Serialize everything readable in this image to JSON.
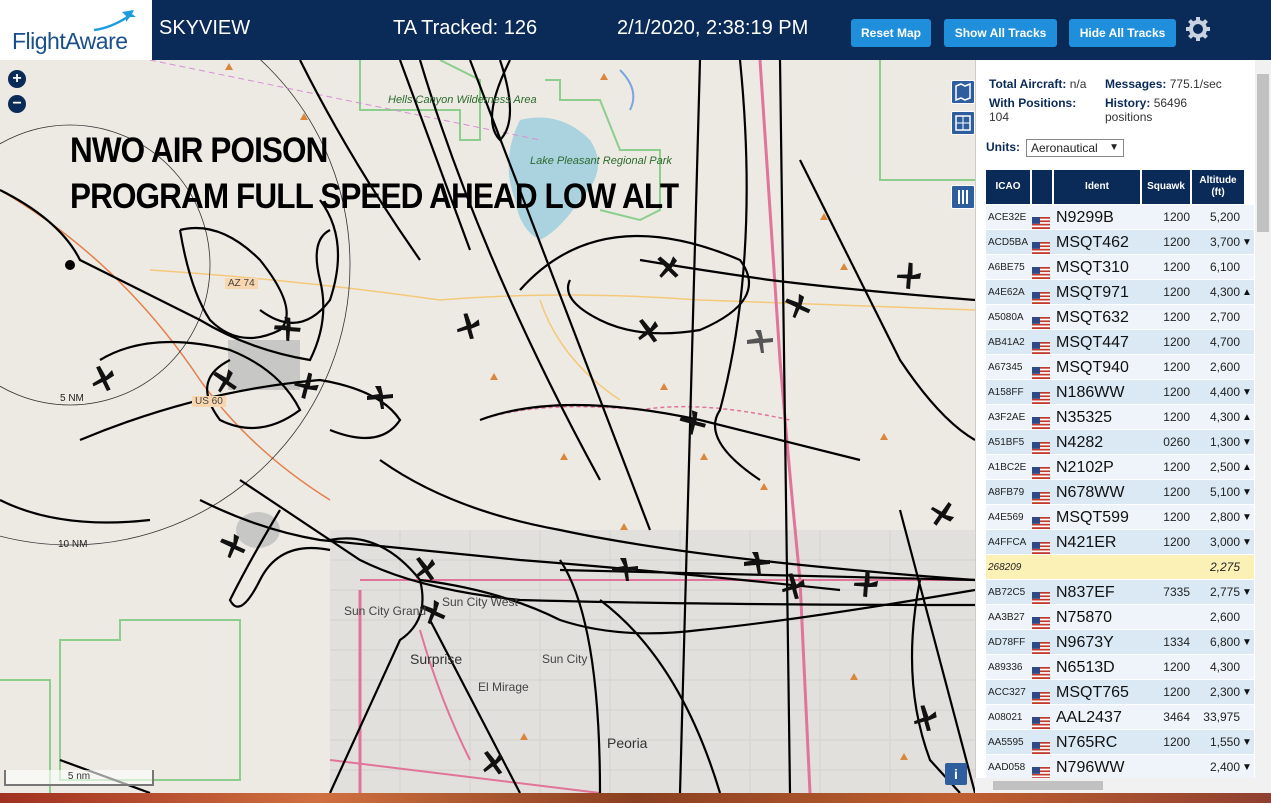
{
  "header": {
    "logo_text": "FlightAware",
    "app_title": "SKYVIEW",
    "tracked": "TA Tracked: 126",
    "datetime": "2/1/2020, 2:38:19 PM",
    "reset_label": "Reset Map",
    "show_label": "Show All Tracks",
    "hide_label": "Hide All Tracks",
    "settings_icon": "gear-icon"
  },
  "map": {
    "zoom_in": "+",
    "zoom_out": "−",
    "overlay_line1": "NWO AIR POISON",
    "overlay_line2": "PROGRAM FULL SPEED AHEAD LOW ALT",
    "ring_5": "5 NM",
    "ring_10": "10 NM",
    "scale_label": "5 nm",
    "info": "i",
    "places": {
      "hells_canyon": "Hells Canyon Wilderness Area",
      "lake_pleasant": "Lake Pleasant Regional Park",
      "sun_city_grand": "Sun City Grand",
      "sun_city_west": "Sun City West",
      "surprise": "Surprise",
      "sun_city": "Sun City",
      "el_mirage": "El Mirage",
      "peoria": "Peoria",
      "az74": "AZ 74",
      "us60": "US 60"
    }
  },
  "panel": {
    "total_label": "Total Aircraft:",
    "total_value": "n/a",
    "messages_label": "Messages:",
    "messages_value": "775.1/sec",
    "positions_label": "With Positions:",
    "positions_value": "104",
    "history_label": "History:",
    "history_value": "56496 positions",
    "units_label": "Units:",
    "units_value": "Aeronautical",
    "columns": [
      "ICAO",
      "Ident",
      "Squawk",
      "Altitude (ft)"
    ],
    "rows": [
      {
        "icao": "ACE32E",
        "ident": "N9299B",
        "squawk": "1200",
        "alt": "5,200",
        "trend": ""
      },
      {
        "icao": "ACD5BA",
        "ident": "MSQT462",
        "squawk": "1200",
        "alt": "3,700",
        "trend": "▼"
      },
      {
        "icao": "A6BE75",
        "ident": "MSQT310",
        "squawk": "1200",
        "alt": "6,100",
        "trend": ""
      },
      {
        "icao": "A4E62A",
        "ident": "MSQT971",
        "squawk": "1200",
        "alt": "4,300",
        "trend": "▲"
      },
      {
        "icao": "A5080A",
        "ident": "MSQT632",
        "squawk": "1200",
        "alt": "2,700",
        "trend": ""
      },
      {
        "icao": "AB41A2",
        "ident": "MSQT447",
        "squawk": "1200",
        "alt": "4,700",
        "trend": ""
      },
      {
        "icao": "A67345",
        "ident": "MSQT940",
        "squawk": "1200",
        "alt": "2,600",
        "trend": ""
      },
      {
        "icao": "A158FF",
        "ident": "N186WW",
        "squawk": "1200",
        "alt": "4,400",
        "trend": "▼"
      },
      {
        "icao": "A3F2AE",
        "ident": "N35325",
        "squawk": "1200",
        "alt": "4,300",
        "trend": "▲"
      },
      {
        "icao": "A51BF5",
        "ident": "N4282",
        "squawk": "0260",
        "alt": "1,300",
        "trend": "▼"
      },
      {
        "icao": "A1BC2E",
        "ident": "N2102P",
        "squawk": "1200",
        "alt": "2,500",
        "trend": "▲"
      },
      {
        "icao": "A8FB79",
        "ident": "N678WW",
        "squawk": "1200",
        "alt": "5,100",
        "trend": "▼"
      },
      {
        "icao": "A4E569",
        "ident": "MSQT599",
        "squawk": "1200",
        "alt": "2,800",
        "trend": "▼"
      },
      {
        "icao": "A4FFCA",
        "ident": "N421ER",
        "squawk": "1200",
        "alt": "3,000",
        "trend": "▼"
      },
      {
        "icao": "268209",
        "ident": "",
        "squawk": "",
        "alt": "2,275",
        "trend": ""
      },
      {
        "icao": "AB72C5",
        "ident": "N837EF",
        "squawk": "7335",
        "alt": "2,775",
        "trend": "▼"
      },
      {
        "icao": "AA3B27",
        "ident": "N75870",
        "squawk": "",
        "alt": "2,600",
        "trend": ""
      },
      {
        "icao": "AD78FF",
        "ident": "N9673Y",
        "squawk": "1334",
        "alt": "6,800",
        "trend": "▼"
      },
      {
        "icao": "A89336",
        "ident": "N6513D",
        "squawk": "1200",
        "alt": "4,300",
        "trend": ""
      },
      {
        "icao": "ACC327",
        "ident": "MSQT765",
        "squawk": "1200",
        "alt": "2,300",
        "trend": "▼"
      },
      {
        "icao": "A08021",
        "ident": "AAL2437",
        "squawk": "3464",
        "alt": "33,975",
        "trend": ""
      },
      {
        "icao": "AA5595",
        "ident": "N765RC",
        "squawk": "1200",
        "alt": "1,550",
        "trend": "▼"
      },
      {
        "icao": "AAD058",
        "ident": "N796WW",
        "squawk": "",
        "alt": "2,400",
        "trend": "▼"
      }
    ]
  },
  "colors": {
    "header_bg": "#0a2a57",
    "button_bg": "#1f8fdc",
    "highlight_row": "#fbf0b6",
    "highway": "#e0749a"
  }
}
